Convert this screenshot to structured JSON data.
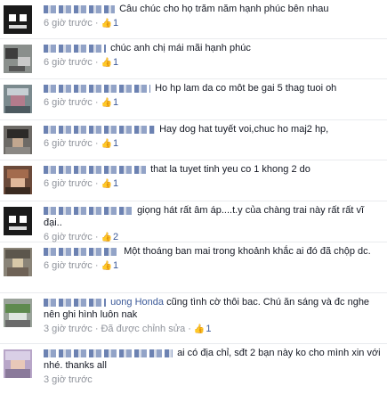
{
  "comments": [
    {
      "text": "Câu chúc cho họ trăm năm hạnh phúc bên nhau",
      "time": "6 giờ trước",
      "likes": "1",
      "edited": ""
    },
    {
      "text": "chúc anh chị mái mãi hạnh phúc",
      "time": "6 giờ trước",
      "likes": "1",
      "edited": ""
    },
    {
      "text": "Ho hp lam da co môt be gai 5 thag tuoi oh",
      "time": "6 giờ trước",
      "likes": "1",
      "edited": ""
    },
    {
      "text": "Hay dog hat tuyết voi,chuc ho maj2 hp,",
      "time": "6 giờ trước",
      "likes": "1",
      "edited": ""
    },
    {
      "text": "that la tuyet tinh yeu co 1 khong 2 do",
      "time": "6 giờ trước",
      "likes": "1",
      "edited": ""
    },
    {
      "text": "giọng hát rất âm áp....t.y của chàng trai này rất rất vĩ đại..",
      "time": "6 giờ trước",
      "likes": "2",
      "edited": ""
    },
    {
      "text": "Một thoáng ban mai trong khoảnh khắc ai đó đã chộp dc.",
      "time": "6 giờ trước",
      "likes": "1",
      "edited": ""
    },
    {
      "mention": "uong Honda",
      "text": "cũng tình cờ thôi bac. Chú ăn sáng và đc nghe nên ghi hình luôn nak",
      "time": "3 giờ trước",
      "likes": "1",
      "edited": "Đã được chỉnh sửa"
    },
    {
      "text": "ai có địa chỉ, sđt 2 bạn này ko cho mình xin với nhé. thanks all",
      "time": "3 giờ trước",
      "likes": "",
      "edited": ""
    }
  ],
  "like_icon": "thumbs-up-icon",
  "colors": {
    "link": "#3b5998",
    "meta": "#90949c",
    "text": "#141823"
  }
}
